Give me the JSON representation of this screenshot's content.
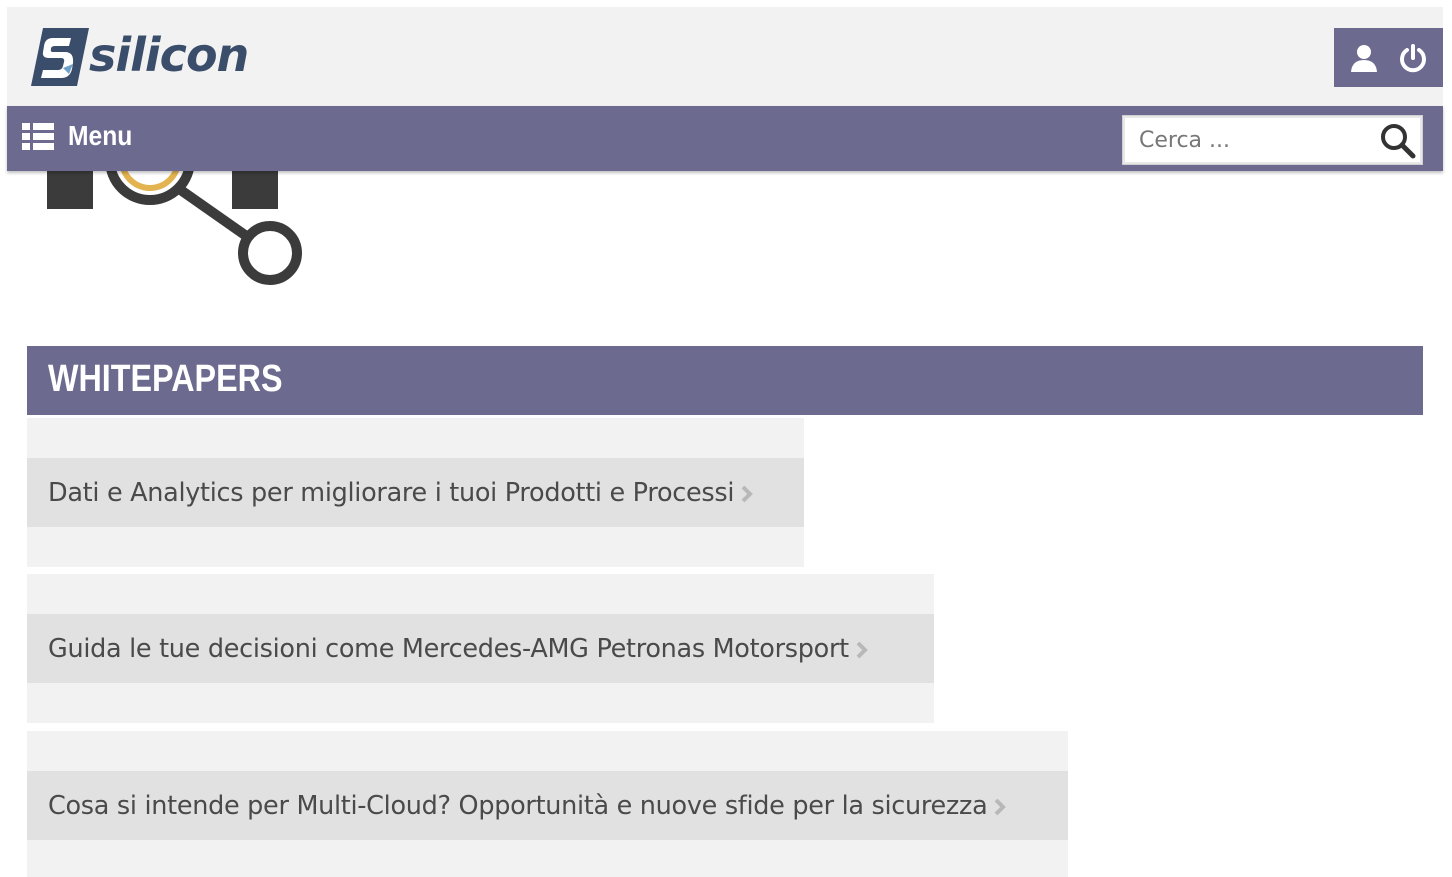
{
  "header": {
    "logo_text": "silicon",
    "icons": [
      "user-icon",
      "power-icon"
    ],
    "colors": {
      "accent": "#6c6a8f",
      "logo": "#3a4d6a",
      "header_bg": "#f2f2f2"
    }
  },
  "menu": {
    "label": "Menu",
    "search_placeholder": "Cerca ..."
  },
  "whitepapers": {
    "title": "WHITEPAPERS",
    "items": [
      {
        "label": "Dati e Analytics per migliorare i tuoi Prodotti e Processi"
      },
      {
        "label": "Guida le tue decisioni come Mercedes-AMG Petronas Motorsport"
      },
      {
        "label": "Cosa si intende per Multi-Cloud? Opportunità e nuove sfide per la sicurezza"
      }
    ]
  }
}
